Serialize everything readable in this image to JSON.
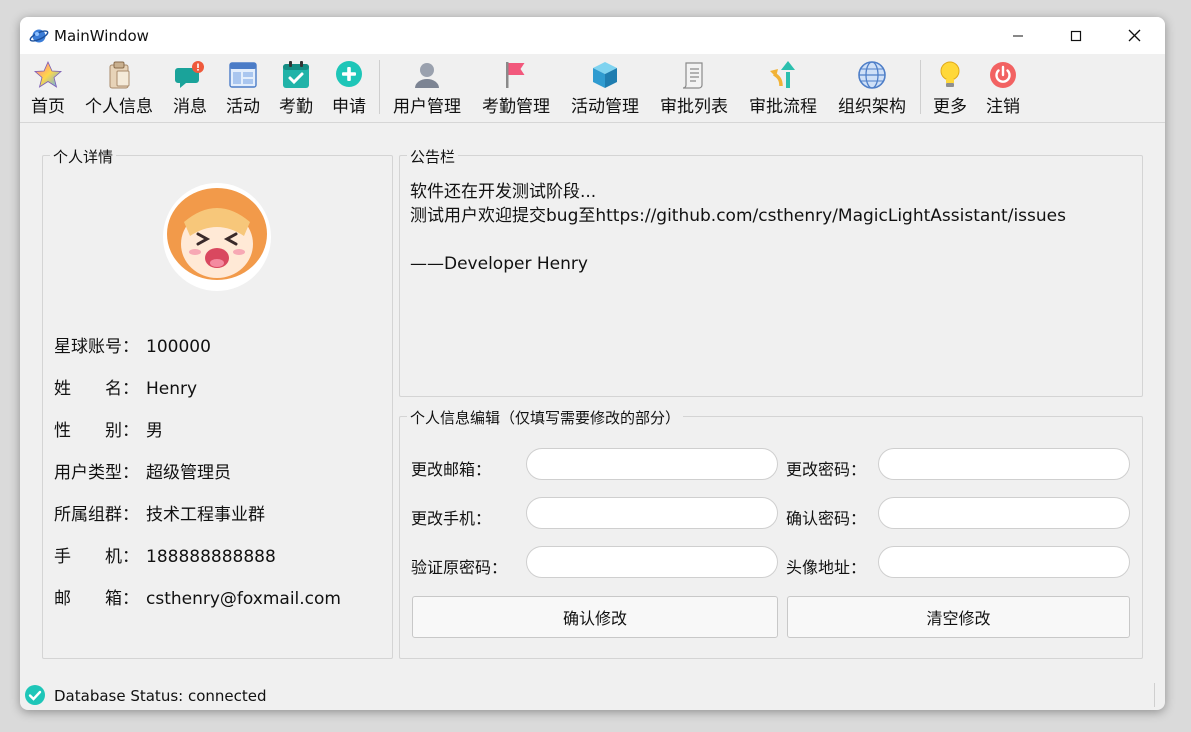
{
  "window": {
    "title": "MainWindow"
  },
  "toolbar": {
    "items": [
      {
        "label": "首页",
        "icon": "star-icon"
      },
      {
        "label": "个人信息",
        "icon": "clipboard-icon"
      },
      {
        "label": "消息",
        "icon": "chat-bubble-icon"
      },
      {
        "label": "活动",
        "icon": "layout-icon"
      },
      {
        "label": "考勤",
        "icon": "calendar-check-icon"
      },
      {
        "label": "申请",
        "icon": "plus-circle-icon"
      },
      {
        "label": "用户管理",
        "icon": "user-icon"
      },
      {
        "label": "考勤管理",
        "icon": "flag-icon"
      },
      {
        "label": "活动管理",
        "icon": "cube-icon"
      },
      {
        "label": "审批列表",
        "icon": "document-list-icon"
      },
      {
        "label": "审批流程",
        "icon": "branch-arrows-icon"
      },
      {
        "label": "组织架构",
        "icon": "globe-icon"
      },
      {
        "label": "更多",
        "icon": "lightbulb-icon"
      },
      {
        "label": "注销",
        "icon": "power-icon"
      }
    ]
  },
  "profile": {
    "title": "个人详情",
    "rows": [
      {
        "label": "星球账号：",
        "value": "100000"
      },
      {
        "label": "姓　　名：",
        "value": "Henry"
      },
      {
        "label": "性　　别：",
        "value": "男"
      },
      {
        "label": "用户类型：",
        "value": "超级管理员"
      },
      {
        "label": "所属组群：",
        "value": "技术工程事业群"
      },
      {
        "label": "手　　机：",
        "value": "188888888888"
      },
      {
        "label": "邮　　箱：",
        "value": "csthenry@foxmail.com"
      }
    ]
  },
  "notice": {
    "title": "公告栏",
    "lines": [
      "软件还在开发测试阶段...",
      "测试用户欢迎提交bug至https://github.com/csthenry/MagicLightAssistant/issues",
      "",
      "——Developer Henry"
    ]
  },
  "edit": {
    "title": "个人信息编辑（仅填写需要修改的部分）",
    "fields": [
      {
        "label": "更改邮箱：",
        "value": ""
      },
      {
        "label": "更改密码：",
        "value": ""
      },
      {
        "label": "更改手机：",
        "value": ""
      },
      {
        "label": "确认密码：",
        "value": ""
      },
      {
        "label": "验证原密码：",
        "value": ""
      },
      {
        "label": "头像地址：",
        "value": ""
      }
    ],
    "confirm_label": "确认修改",
    "clear_label": "清空修改"
  },
  "status": {
    "text": "Database Status: connected"
  },
  "colors": {
    "accent": "#1ec6b8",
    "window_bg": "#f0f0f0",
    "border": "#d4d4d4"
  }
}
